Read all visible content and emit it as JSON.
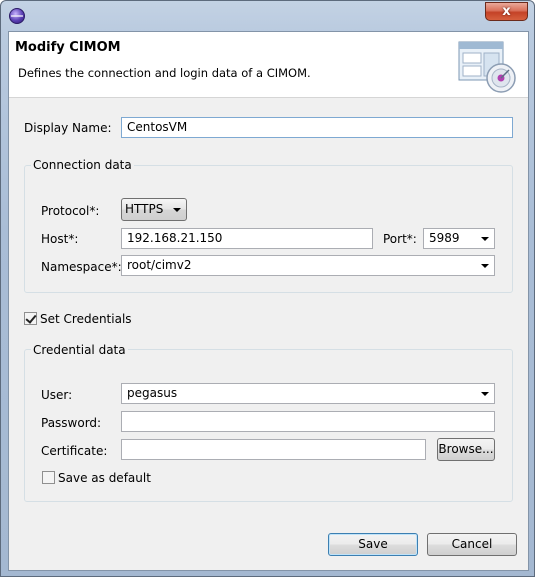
{
  "window": {
    "close_label": "x"
  },
  "banner": {
    "title": "Modify CIMOM",
    "description": "Defines the connection and login data of a CIMOM."
  },
  "display_name": {
    "label": "Display Name:",
    "value": "CentosVM"
  },
  "connection": {
    "group_label": "Connection data",
    "protocol": {
      "label": "Protocol*:",
      "value": "HTTPS"
    },
    "host": {
      "label": "Host*:",
      "value": "192.168.21.150"
    },
    "port": {
      "label": "Port*:",
      "value": "5989"
    },
    "namespace": {
      "label": "Namespace*:",
      "value": "root/cimv2"
    }
  },
  "set_credentials": {
    "label": "Set Credentials",
    "checked": true
  },
  "credentials": {
    "group_label": "Credential data",
    "user": {
      "label": "User:",
      "value": "pegasus"
    },
    "password": {
      "label": "Password:",
      "value": ""
    },
    "certificate": {
      "label": "Certificate:",
      "value": ""
    },
    "browse_label": "Browse...",
    "save_default": {
      "label": "Save as default",
      "checked": false
    }
  },
  "buttons": {
    "save": "Save",
    "cancel": "Cancel"
  },
  "icons": {
    "app": "eclipse-icon",
    "banner": "cimom-wizard-icon"
  }
}
